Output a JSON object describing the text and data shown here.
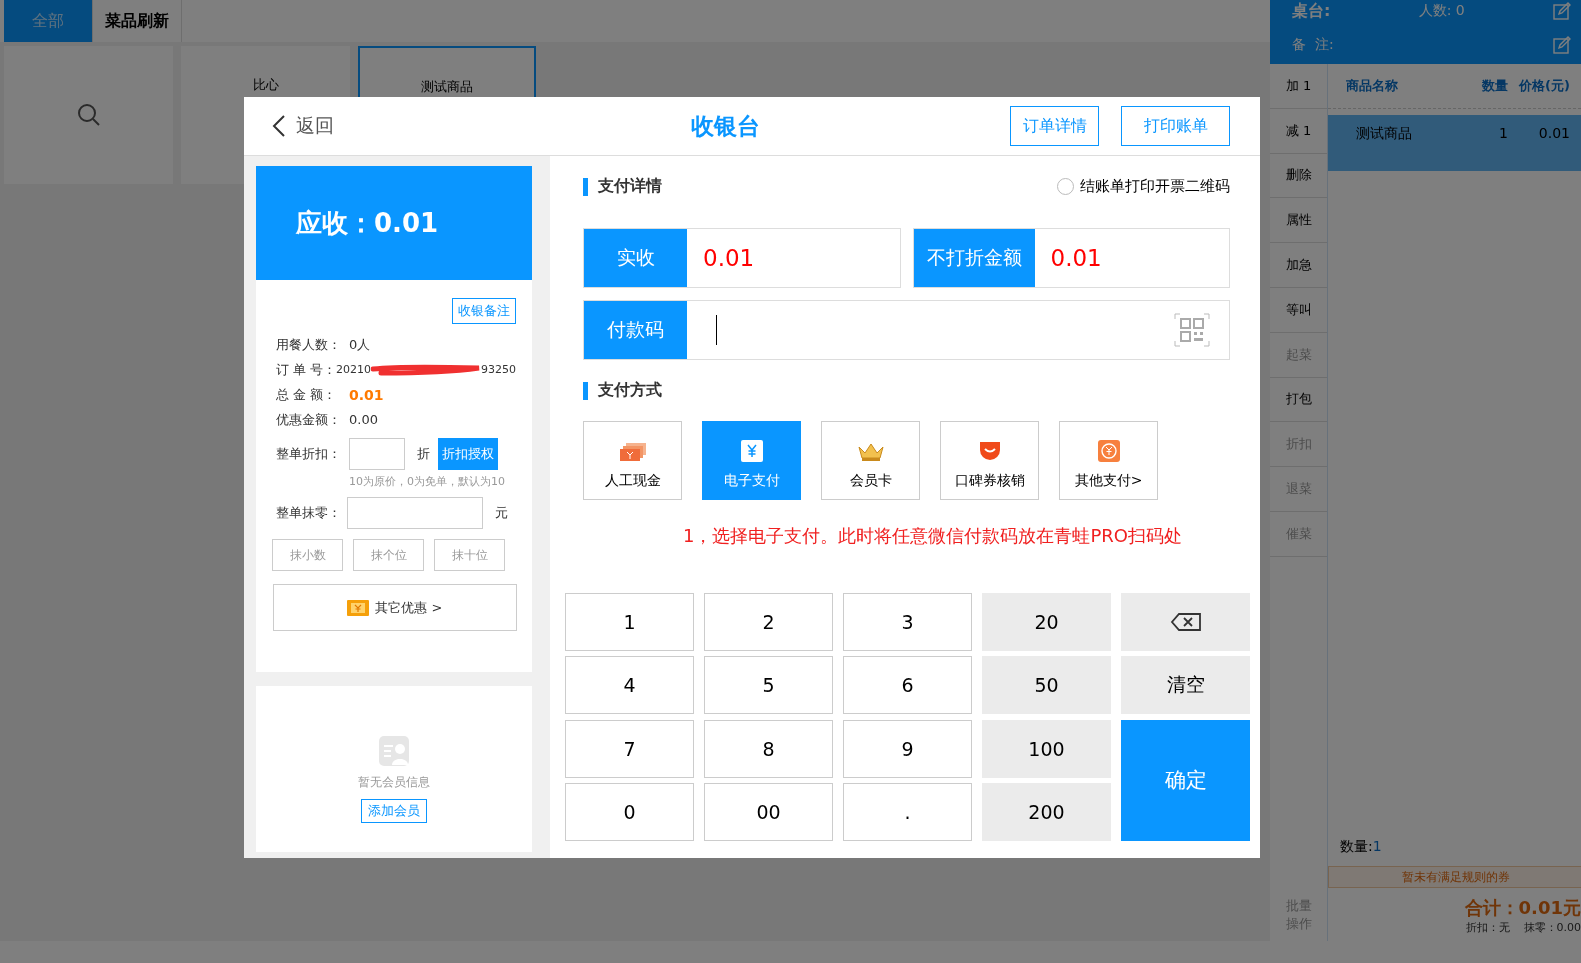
{
  "background": {
    "tabs": [
      {
        "label": "全部",
        "selected": true
      },
      {
        "label": "菜品刷新",
        "selected": false
      }
    ],
    "products": [
      {
        "kind": "search",
        "selected": false
      },
      {
        "kind": "item",
        "name": "比心",
        "selected": false
      },
      {
        "kind": "item",
        "name": "测试商品",
        "selected": true
      }
    ],
    "order_panel": {
      "table_label": "桌台:",
      "guests": "人数: 0",
      "remark_label": "备  注:",
      "actions": [
        {
          "label": "加 1",
          "disabled": false
        },
        {
          "label": "减 1",
          "disabled": false
        },
        {
          "label": "删除",
          "disabled": false
        },
        {
          "label": "属性",
          "disabled": false
        },
        {
          "label": "加急",
          "disabled": false
        },
        {
          "label": "等叫",
          "disabled": false
        },
        {
          "label": "起菜",
          "disabled": true
        },
        {
          "label": "打包",
          "disabled": false
        },
        {
          "label": "折扣",
          "disabled": true
        },
        {
          "label": "退菜",
          "disabled": true
        },
        {
          "label": "催菜",
          "disabled": true
        }
      ],
      "batch": {
        "label": "批量操作",
        "disabled": true
      },
      "columns": [
        "商品名称",
        "数量",
        "价格(元)"
      ],
      "rows": [
        {
          "cells": [
            "测试商品",
            "1",
            "0.01"
          ],
          "selected": true
        }
      ],
      "quantity_label": "数量:",
      "quantity": "1",
      "coupon_notice": "暂未有满足规则的券",
      "total": "合计：0.01元",
      "discount": "折扣：无",
      "rounding": "抹零：0.00"
    }
  },
  "dialog": {
    "back": "返回",
    "title": "收银台",
    "header_buttons": [
      "订单详情",
      "打印账单"
    ],
    "receivable": "应收：0.01",
    "note_button": "收银备注",
    "info": [
      {
        "kind": "plain",
        "label": "用餐人数：",
        "value": "0人"
      },
      {
        "kind": "redacted",
        "label": "订 单 号：",
        "value": "20210",
        "value_end": "93250"
      },
      {
        "kind": "highlight",
        "label": "总 金 额：",
        "value": "0.01"
      },
      {
        "kind": "plain",
        "label": "优惠金额：",
        "value": "0.00"
      }
    ],
    "discount": {
      "label": "整单折扣：",
      "unit": "折",
      "button": "折扣授权",
      "hint": "10为原价，0为免单，默认为10"
    },
    "rounding": {
      "label": "整单抹零：",
      "unit": "元",
      "buttons": [
        "抹小数",
        "抹个位",
        "抹十位"
      ]
    },
    "other_offers": "其它优惠 >",
    "member": {
      "empty_text": "暂无会员信息",
      "add_button": "添加会员"
    },
    "pay_details_title": "支付详情",
    "print_qr": {
      "label": "结账单打印开票二维码",
      "checked": false
    },
    "amounts": [
      {
        "label": "实收",
        "value": "0.01"
      },
      {
        "label": "不打折金额",
        "value": "0.01"
      }
    ],
    "pay_code": {
      "label": "付款码"
    },
    "methods_title": "支付方式",
    "methods": [
      {
        "kind": "cash",
        "label": "人工现金",
        "selected": false
      },
      {
        "kind": "epay",
        "label": "电子支付",
        "selected": true
      },
      {
        "kind": "member",
        "label": "会员卡",
        "selected": false
      },
      {
        "kind": "koubei",
        "label": "口碑券核销",
        "selected": false
      },
      {
        "kind": "other",
        "label": "其他支付>",
        "selected": false
      }
    ],
    "instruction": "1，选择电子支付。此时将任意微信付款码放在青蛙PRO扫码处",
    "keypad": [
      {
        "kind": "digit",
        "label": "1"
      },
      {
        "kind": "digit",
        "label": "2"
      },
      {
        "kind": "digit",
        "label": "3"
      },
      {
        "kind": "quick",
        "label": "20"
      },
      {
        "kind": "backspace"
      },
      {
        "kind": "digit",
        "label": "4"
      },
      {
        "kind": "digit",
        "label": "5"
      },
      {
        "kind": "digit",
        "label": "6"
      },
      {
        "kind": "quick",
        "label": "50"
      },
      {
        "kind": "clear",
        "label": "清空"
      },
      {
        "kind": "digit",
        "label": "7"
      },
      {
        "kind": "digit",
        "label": "8"
      },
      {
        "kind": "digit",
        "label": "9"
      },
      {
        "kind": "quick",
        "label": "100"
      },
      {
        "kind": "confirm",
        "label": "确定"
      },
      {
        "kind": "digit",
        "label": "0"
      },
      {
        "kind": "digit",
        "label": "00"
      },
      {
        "kind": "digit",
        "label": "."
      },
      {
        "kind": "quick",
        "label": "200"
      }
    ]
  }
}
